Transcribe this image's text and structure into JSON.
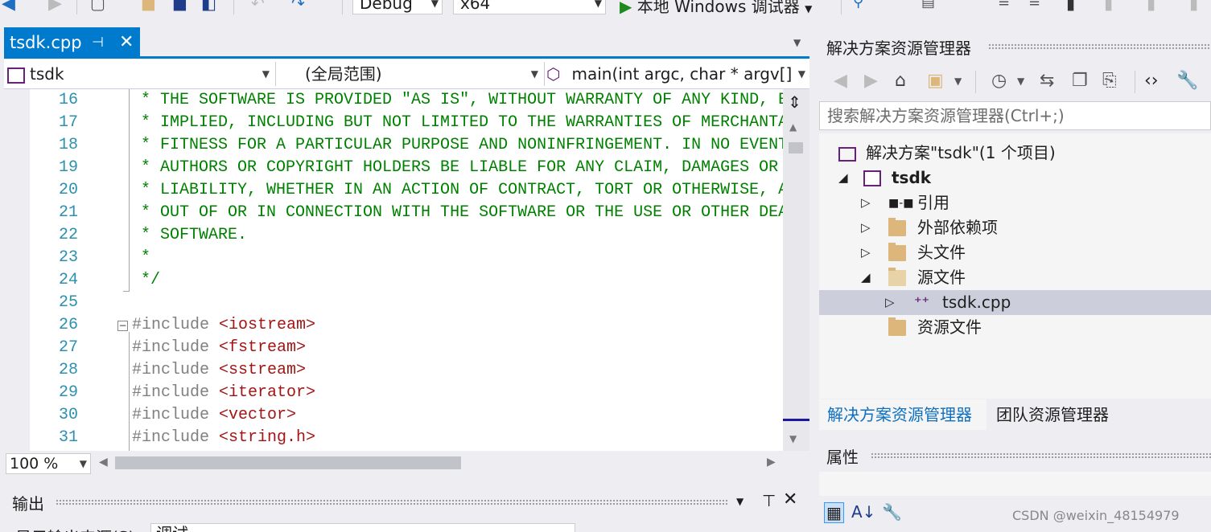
{
  "toolbar": {
    "config_value": "Debug",
    "platform_value": "x64",
    "run_label": "本地 Windows 调试器"
  },
  "editor_tab": {
    "label": "tsdk.cpp"
  },
  "navbar": {
    "project": "tsdk",
    "scope": "(全局范围)",
    "member": "main(int argc, char * argv[]"
  },
  "code_lines": [
    {
      "n": "16",
      "text": "* THE SOFTWARE IS PROVIDED \"AS IS\", WITHOUT WARRANTY OF ANY KIND, E"
    },
    {
      "n": "17",
      "text": "* IMPLIED, INCLUDING BUT NOT LIMITED TO THE WARRANTIES OF MERCHANTA"
    },
    {
      "n": "18",
      "text": "* FITNESS FOR A PARTICULAR PURPOSE AND NONINFRINGEMENT. IN NO EVENT"
    },
    {
      "n": "19",
      "text": "* AUTHORS OR COPYRIGHT HOLDERS BE LIABLE FOR ANY CLAIM, DAMAGES OR"
    },
    {
      "n": "20",
      "text": "* LIABILITY, WHETHER IN AN ACTION OF CONTRACT, TORT OR OTHERWISE, A"
    },
    {
      "n": "21",
      "text": "* OUT OF OR IN CONNECTION WITH THE SOFTWARE OR THE USE OR OTHER DEA"
    },
    {
      "n": "22",
      "text": "* SOFTWARE."
    },
    {
      "n": "23",
      "text": "*"
    },
    {
      "n": "24",
      "text": "*/"
    },
    {
      "n": "25",
      "text": ""
    },
    {
      "n": "26",
      "pre": "#include ",
      "inc": "<iostream>"
    },
    {
      "n": "27",
      "pre": "#include ",
      "inc": "<fstream>"
    },
    {
      "n": "28",
      "pre": "#include ",
      "inc": "<sstream>"
    },
    {
      "n": "29",
      "pre": "#include ",
      "inc": "<iterator>"
    },
    {
      "n": "30",
      "pre": "#include ",
      "inc": "<vector>"
    },
    {
      "n": "31",
      "pre": "#include ",
      "inc": "<string.h>"
    }
  ],
  "zoom": {
    "value": "100 %"
  },
  "output": {
    "title": "输出",
    "source_label": "显示输出来源(S):",
    "source_value": "调试"
  },
  "solution_explorer": {
    "title": "解决方案资源管理器",
    "search_placeholder": "搜索解决方案资源管理器(Ctrl+;)",
    "tree": [
      {
        "label": "解决方案\"tsdk\"(1 个项目)",
        "icon": "solution-icon"
      },
      {
        "label": "tsdk",
        "icon": "project-icon",
        "bold": true
      },
      {
        "label": "引用",
        "icon": "references-icon"
      },
      {
        "label": "外部依赖项",
        "icon": "external-deps-icon"
      },
      {
        "label": "头文件",
        "icon": "folder-icon"
      },
      {
        "label": "源文件",
        "icon": "folder-open-icon"
      },
      {
        "label": "tsdk.cpp",
        "icon": "cpp-file-icon"
      },
      {
        "label": "资源文件",
        "icon": "folder-icon"
      }
    ],
    "tabs": [
      "解决方案资源管理器",
      "团队资源管理器"
    ]
  },
  "properties": {
    "title": "属性"
  },
  "watermark": "CSDN @weixin_48154979"
}
